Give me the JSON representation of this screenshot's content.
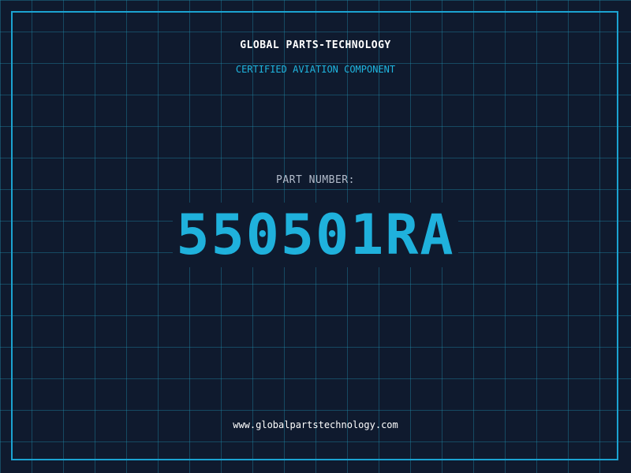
{
  "header": {
    "brand": "GLOBAL PARTS-TECHNOLOGY",
    "tagline": "CERTIFIED AVIATION COMPONENT"
  },
  "part": {
    "label": "PART NUMBER:",
    "number": "550501RA"
  },
  "footer": {
    "website": "www.globalpartstechnology.com"
  },
  "colors": {
    "background": "#0f1a2e",
    "grid": "#1a6f8a",
    "accent": "#1fb1dc",
    "frame": "#1ba3d1"
  }
}
